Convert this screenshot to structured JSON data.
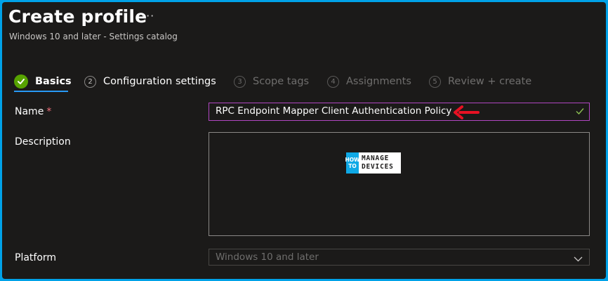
{
  "header": {
    "title": "Create profile",
    "more": "···",
    "subtitle": "Windows 10 and later - Settings catalog"
  },
  "tabs": [
    {
      "num": "",
      "label": "Basics",
      "state": "completed"
    },
    {
      "num": "2",
      "label": "Configuration settings",
      "state": "enabled"
    },
    {
      "num": "3",
      "label": "Scope tags",
      "state": "disabled"
    },
    {
      "num": "4",
      "label": "Assignments",
      "state": "disabled"
    },
    {
      "num": "5",
      "label": "Review + create",
      "state": "disabled"
    }
  ],
  "form": {
    "name_label": "Name",
    "required_mark": "*",
    "name_value": "RPC Endpoint Mapper Client Authentication Policy",
    "description_label": "Description",
    "description_value": "",
    "platform_label": "Platform",
    "platform_value": "Windows 10 and later"
  },
  "watermark": {
    "line1": "HOW",
    "line2": "TO",
    "line3": "MANAGE",
    "line4": "DEVICES"
  },
  "colors": {
    "accent": "#2899f5",
    "success": "#57a300",
    "focus_border": "#b146c2",
    "required": "#f1707b",
    "annotation_arrow": "#e81123",
    "frame_border": "#00a2e8"
  },
  "icons": {
    "completed": "checkmark-circle-icon",
    "valid": "checkmark-icon",
    "dropdown": "chevron-down-icon",
    "annotation": "red-arrow-icon"
  }
}
